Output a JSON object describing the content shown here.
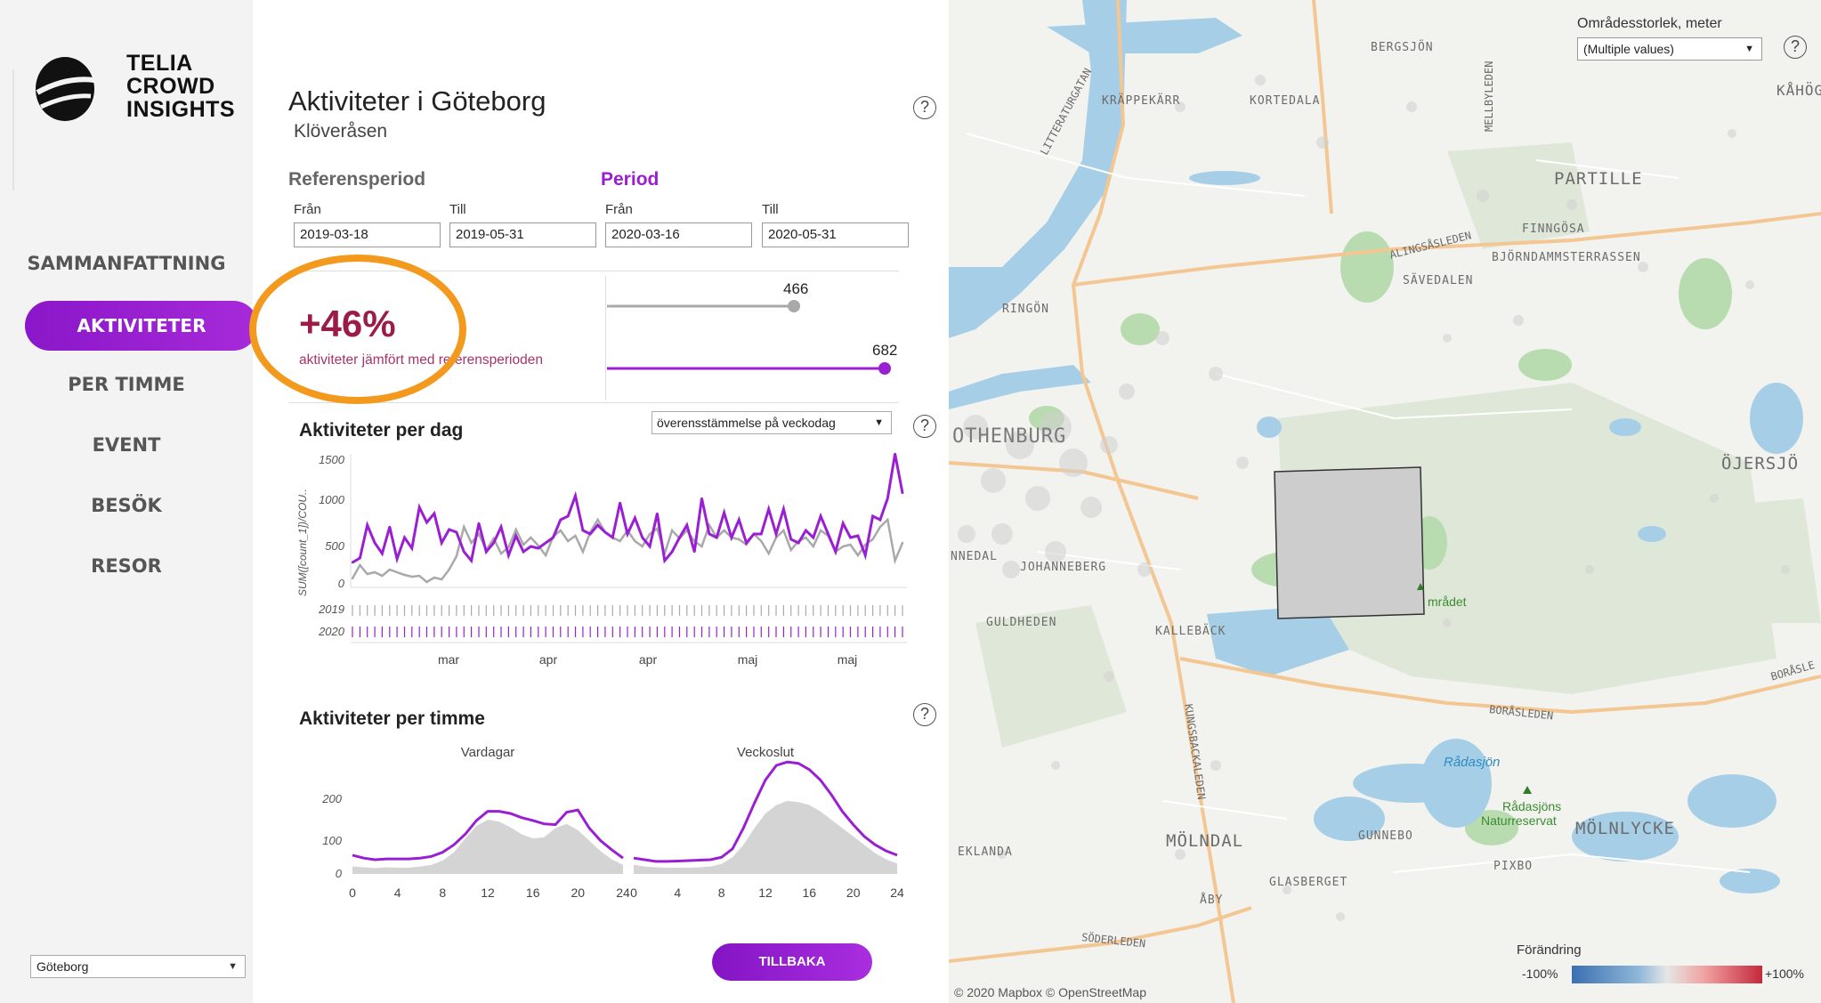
{
  "sidebar": {
    "logo_lines": [
      "TELIA",
      "CROWD",
      "INSIGHTS"
    ],
    "nav": [
      {
        "label": "SAMMANFATTNING"
      },
      {
        "label": "AKTIVITETER"
      },
      {
        "label": "PER TIMME"
      },
      {
        "label": "EVENT"
      },
      {
        "label": "BESÖK"
      },
      {
        "label": "RESOR"
      }
    ],
    "active_nav": "AKTIVITETER",
    "city_select": "Göteborg"
  },
  "header": {
    "title": "Aktiviteter i Göteborg",
    "subtitle": "Klöveråsen",
    "help_glyph": "?"
  },
  "periods": {
    "reference_label": "Referensperiod",
    "period_label": "Period",
    "from_label": "Från",
    "to_label": "Till",
    "reference_from": "2019-03-18",
    "reference_to": "2019-05-31",
    "period_from": "2020-03-16",
    "period_to": "2020-05-31"
  },
  "summary": {
    "change_pct": "+46%",
    "description": "aktiviteter jämfört med referensperioden",
    "reference_value": "466",
    "period_value": "682",
    "colors": {
      "reference": "#a9a9a9",
      "period": "#9a1fd3"
    }
  },
  "daily_chart": {
    "title": "Aktiviteter per dag",
    "dropdown": "överensstämmelse på veckodag",
    "ylabel": "SUM([count_1])/COU..",
    "yticks": [
      "1500",
      "1000",
      "500",
      "0"
    ],
    "row_labels": [
      "2019",
      "2020"
    ],
    "xticks": [
      "mar",
      "apr",
      "apr",
      "maj",
      "maj"
    ]
  },
  "hourly_chart": {
    "title": "Aktiviteter per timme",
    "panels": [
      "Vardagar",
      "Veckoslut"
    ],
    "yticks": [
      "200",
      "100",
      "0"
    ],
    "xticks": [
      "0",
      "4",
      "8",
      "12",
      "16",
      "20",
      "24"
    ]
  },
  "back_button": "TILLBAKA",
  "map": {
    "area_size_label": "Områdesstorlek, meter",
    "area_size_value": "(Multiple values)",
    "legend_title": "Förändring",
    "legend_min": "-100%",
    "legend_max": "+100%",
    "attribution": "© 2020 Mapbox © OpenStreetMap",
    "places": [
      "BERGSJÖN",
      "KÅHÖG",
      "KRÄPPEKÄRR",
      "KORTEDALA",
      "PARTILLE",
      "FINNGÖSA",
      "BJÖRNDAMMSTERRASSEN",
      "SÄVEDALEN",
      "RINGÖN",
      "ÖJERSJÖ",
      "OTHENBURG",
      "NNEDAL",
      "JOHANNEBERG",
      "GULDHEDEN",
      "KALLEBÄCK",
      "MÖLNDAL",
      "GUNNEBO",
      "MÖLNLYCKE",
      "EKLANDA",
      "PIXBO",
      "GLASBERGET",
      "ÅBY"
    ],
    "roads": [
      "LITTERATURGATAN",
      "MELLBYLEDEN",
      "ALINGSÅSLEDEN",
      "BORÅSLEDEN",
      "BORÅSLE",
      "KUNGSBACKALEDEN",
      "SÖDERLEDEN"
    ],
    "park_labels": [
      "Rådasjöns",
      "Naturreservat",
      "mrådet"
    ],
    "lake_label": "Rådasjön"
  },
  "chart_data": [
    {
      "type": "line",
      "title": "Aktiviteter per dag",
      "ylabel": "SUM([count_1])/COU..",
      "ylim": [
        0,
        1500
      ],
      "x": [
        1,
        2,
        3,
        4,
        5,
        6,
        7,
        8,
        9,
        10,
        11,
        12,
        13,
        14,
        15,
        16,
        17,
        18,
        19,
        20,
        21,
        22,
        23,
        24,
        25,
        26,
        27,
        28,
        29,
        30,
        31,
        32,
        33,
        34,
        35,
        36,
        37,
        38,
        39,
        40,
        41,
        42,
        43,
        44,
        45,
        46,
        47,
        48,
        49,
        50,
        51,
        52,
        53,
        54,
        55,
        56,
        57,
        58,
        59,
        60,
        61,
        62,
        63,
        64,
        65,
        66,
        67,
        68,
        69,
        70,
        71,
        72,
        73,
        74,
        75
      ],
      "series": [
        {
          "name": "2019",
          "values": [
            100,
            250,
            150,
            170,
            130,
            200,
            170,
            140,
            120,
            130,
            60,
            110,
            90,
            200,
            350,
            680,
            500,
            600,
            420,
            550,
            380,
            450,
            650,
            480,
            560,
            470,
            360,
            570,
            640,
            520,
            580,
            400,
            620,
            760,
            620,
            560,
            520,
            640,
            520,
            460,
            600,
            660,
            380,
            640,
            550,
            640,
            520,
            460,
            700,
            560,
            640,
            560,
            540,
            480,
            600,
            520,
            380,
            560,
            640,
            420,
            520,
            560,
            460,
            640,
            580,
            400,
            460,
            480,
            360,
            480,
            540,
            680,
            760,
            300,
            500
          ]
        },
        {
          "name": "2020",
          "values": [
            280,
            330,
            700,
            500,
            380,
            680,
            320,
            560,
            440,
            900,
            730,
            830,
            500,
            650,
            620,
            400,
            300,
            720,
            400,
            500,
            680,
            360,
            580,
            400,
            460,
            440,
            500,
            560,
            760,
            800,
            1030,
            640,
            600,
            700,
            620,
            560,
            950,
            600,
            780,
            560,
            460,
            830,
            300,
            400,
            560,
            700,
            400,
            1000,
            600,
            560,
            840,
            560,
            760,
            500,
            600,
            600,
            880,
            600,
            880,
            540,
            500,
            640,
            560,
            800,
            600,
            400,
            720,
            560,
            580,
            360,
            800,
            760,
            1000,
            1500,
            1060
          ]
        }
      ]
    },
    {
      "type": "area",
      "title": "Vardagar",
      "ylim": [
        0,
        260
      ],
      "x": [
        0,
        1,
        2,
        3,
        4,
        5,
        6,
        7,
        8,
        9,
        10,
        11,
        12,
        13,
        14,
        15,
        16,
        17,
        18,
        19,
        20,
        21,
        22,
        23,
        24
      ],
      "series": [
        {
          "name": "2019",
          "values": [
            18,
            16,
            14,
            16,
            15,
            15,
            18,
            22,
            32,
            52,
            85,
            115,
            130,
            125,
            112,
            95,
            85,
            88,
            110,
            120,
            105,
            80,
            55,
            35,
            22
          ]
        },
        {
          "name": "2020",
          "values": [
            45,
            38,
            34,
            36,
            36,
            36,
            38,
            42,
            52,
            70,
            95,
            128,
            150,
            150,
            145,
            135,
            128,
            120,
            118,
            148,
            153,
            110,
            80,
            58,
            38
          ]
        }
      ]
    },
    {
      "type": "area",
      "title": "Veckoslut",
      "ylim": [
        0,
        260
      ],
      "x": [
        0,
        1,
        2,
        3,
        4,
        5,
        6,
        7,
        8,
        9,
        10,
        11,
        12,
        13,
        14,
        15,
        16,
        17,
        18,
        19,
        20,
        21,
        22,
        23,
        24
      ],
      "series": [
        {
          "name": "2019",
          "values": [
            22,
            18,
            16,
            15,
            15,
            15,
            16,
            18,
            24,
            40,
            70,
            110,
            145,
            165,
            175,
            172,
            165,
            150,
            130,
            110,
            90,
            70,
            50,
            35,
            25
          ]
        },
        {
          "name": "2020",
          "values": [
            38,
            34,
            30,
            30,
            31,
            32,
            33,
            34,
            40,
            60,
            110,
            170,
            225,
            260,
            268,
            265,
            250,
            225,
            190,
            150,
            118,
            90,
            70,
            55,
            45
          ]
        }
      ]
    }
  ]
}
